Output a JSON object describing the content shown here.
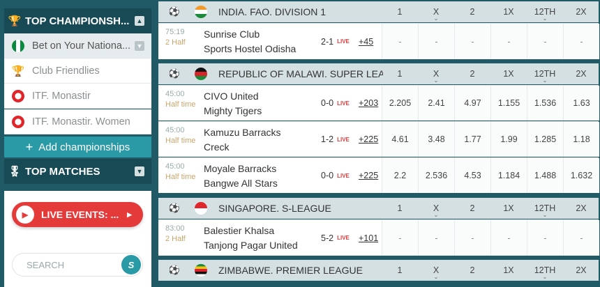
{
  "sidebar": {
    "championships_title": "TOP CHAMPIONSH...",
    "items": [
      {
        "label": "Bet on Your Nationa...",
        "icon": "nigeria-flag-icon",
        "active": true
      },
      {
        "label": "Club Friendlies",
        "icon": "trophy-icon"
      },
      {
        "label": "ITF. Monastir",
        "icon": "tunisia-flag-icon"
      },
      {
        "label": "ITF. Monastir. Women",
        "icon": "tunisia-flag-icon"
      }
    ],
    "add_label": "Add championships",
    "top_matches_title": "TOP MATCHES",
    "live_events_label": "LIVE EVENTS: ...",
    "search_placeholder": "SEARCH"
  },
  "columns": [
    "1",
    "X",
    "2",
    "1X",
    "12TH",
    "2X"
  ],
  "leagues": [
    {
      "name": "INDIA. FAO. DIVISION 1",
      "flag": "india",
      "events": [
        {
          "time": "75:19",
          "period": "2 Half",
          "team1": "Sunrise Club",
          "team2": "Sports Hostel Odisha",
          "score": "2-1",
          "live": "LIVE",
          "more": "+45",
          "odds": [
            "-",
            "-",
            "-",
            "-",
            "-",
            "-"
          ]
        }
      ]
    },
    {
      "name": "REPUBLIC OF MALAWI. SUPER LEA...",
      "flag": "malawi",
      "events": [
        {
          "time": "45:00",
          "period": "Half time",
          "team1": "CIVO United",
          "team2": "Mighty Tigers",
          "score": "0-0",
          "live": "LIVE",
          "more": "+203",
          "odds": [
            "2.205",
            "2.41",
            "4.97",
            "1.155",
            "1.536",
            "1.63"
          ]
        },
        {
          "time": "45:00",
          "period": "Half time",
          "team1": "Kamuzu Barracks",
          "team2": "Creck",
          "score": "1-2",
          "live": "LIVE",
          "more": "+225",
          "odds": [
            "4.61",
            "3.48",
            "1.77",
            "1.99",
            "1.285",
            "1.18"
          ]
        },
        {
          "time": "45:00",
          "period": "Half time",
          "team1": "Moyale Barracks",
          "team2": "Bangwe All Stars",
          "score": "0-0",
          "live": "LIVE",
          "more": "+225",
          "odds": [
            "2.2",
            "2.536",
            "4.53",
            "1.184",
            "1.488",
            "1.632"
          ]
        }
      ]
    },
    {
      "name": "SINGAPORE. S-LEAGUE",
      "flag": "singapore",
      "events": [
        {
          "time": "83:00",
          "period": "2 Half",
          "team1": "Balestier Khalsa",
          "team2": "Tanjong Pagar United",
          "score": "5-2",
          "live": "LIVE",
          "more": "+101",
          "odds": [
            "-",
            "-",
            "-",
            "-",
            "-",
            "-"
          ]
        }
      ]
    },
    {
      "name": "ZIMBABWE. PREMIER LEAGUE",
      "flag": "zimbabwe",
      "events": []
    }
  ],
  "colors": {
    "sidebar_bg": "#1f5a66",
    "accent": "#2a9aa6",
    "live_red": "#e53a3a",
    "league_header_bg": "#d5e0e3"
  }
}
